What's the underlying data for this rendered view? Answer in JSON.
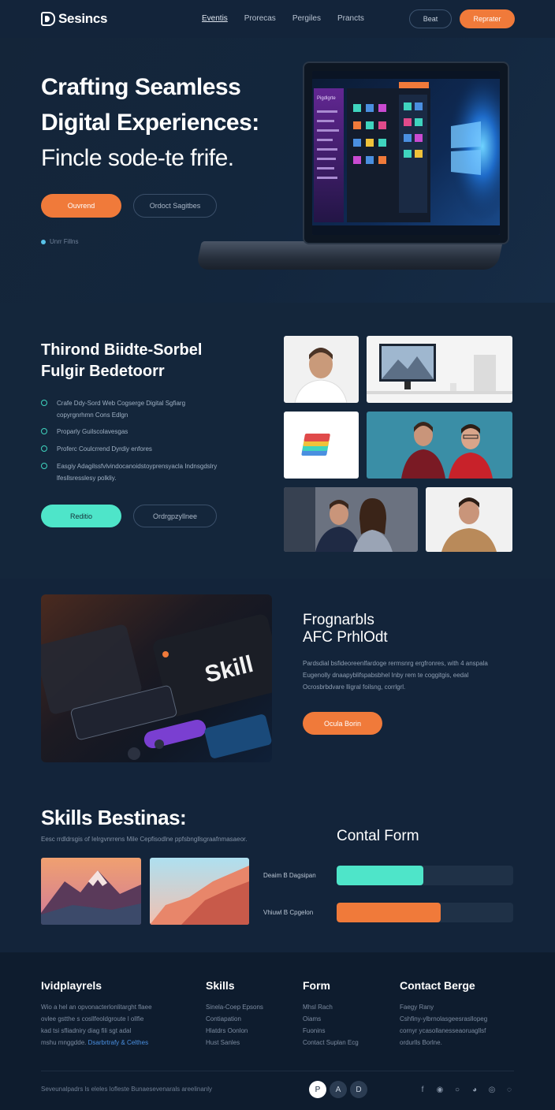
{
  "brand": {
    "name": "Sesincs"
  },
  "nav": {
    "items": [
      "Eventis",
      "Prorecas",
      "Pergiles",
      "Prancts"
    ]
  },
  "header": {
    "signin_label": "Beat",
    "register_label": "Reprater"
  },
  "hero": {
    "title_line1": "Crafting Seamless",
    "title_line2": "Digital Experiences:",
    "title_line3": "Fincle sode-te frife.",
    "primary_button": "Ouvrend",
    "secondary_button": "Ordoct Sagitbes",
    "note": "Unrr Fillns"
  },
  "section2": {
    "title_line1": "Thirond Biidte-Sorbel",
    "title_line2": "Fulgir Bedetoorr",
    "features": [
      "Crafe Ddy-Sord Web Cogserge Digital Sgfiarg copyrgnrhmn Cons Edlgn",
      "Proparly Guilscolavesgas",
      "Proferc Coulcrrend Dyrdiy enfores",
      "Easgiy Adagilssfvlvindocanoidstoyprensyacla Indnsgdslry lfesllsresslesy polkliy."
    ],
    "primary_button": "Reditio",
    "secondary_button": "Ordrgpzyllnee"
  },
  "section3": {
    "image_word": "Skill",
    "title_line1": "Frognarbls",
    "title_line2": "AFC PrhlOdt",
    "description": "Pardsdial bsfideoreenlfardoge rermsnrg ergfronres, with 4 anspala Eugenolly dnaapyblifspabsbhel Inby rem te coggitgis, eedal Ocrosbrbdvare lligral foilsng, corrlgrl.",
    "button": "Ocula Borin"
  },
  "section4": {
    "title": "Skills Bestinas:",
    "description": "Eesc rrdldrsgis of Ielrgvnrrens Mile Cepfisodlne ppfsbngllsgraafnmasaeor."
  },
  "contact": {
    "title": "Contal Form",
    "bars": [
      {
        "label": "Deaim B Dagsipan",
        "value": 0.49,
        "color": "#4ee5c9"
      },
      {
        "label": "Vhiuwl B Cpgelon",
        "value": 0.59,
        "color": "#f07a3a"
      }
    ]
  },
  "footer": {
    "columns": [
      {
        "title": "Ividplayrels",
        "lines": [
          "Wio a hel an opvonacterlonlitarght flaee",
          "ovlee gstthe s cosllfeoldgroute l ollfie",
          "kad tsi sfliadniry diag fili sgt adal",
          "mshu mnggdde."
        ],
        "link": "Dsarbrtrafy & Celthes"
      },
      {
        "title": "Skills",
        "lines": [
          "Sinela-Coep Epsons",
          "Contiapation",
          "Hlatdrs Oonlon",
          "Hust Sanles"
        ]
      },
      {
        "title": "Form",
        "lines": [
          "Mhsl Rach",
          "Oiams",
          "Fuonins",
          "Contact Suplan Ecg"
        ]
      },
      {
        "title": "Contact Berge",
        "lines": [
          "Faegy Rany",
          "Cshfiny-ylbrnolasgeesrasllopeg",
          "cornyr ycasollanesseaoruagllsf",
          "ordurlls Borlne."
        ]
      }
    ],
    "copyright": "Seveunalpadrs ls eleles lofleste Bunaesevenarals areelinanly",
    "circle_icons": [
      "P",
      "A",
      "D"
    ]
  },
  "hero_image": {
    "sidebar_title": "Pigdlgrte"
  }
}
